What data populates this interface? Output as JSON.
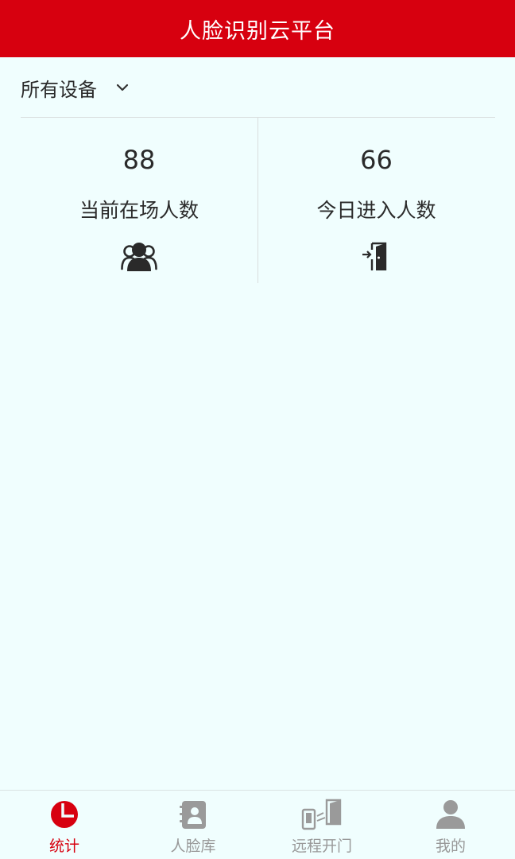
{
  "header": {
    "title": "人脸识别云平台"
  },
  "device_selector": {
    "label": "所有设备",
    "icon": "chevron-down-icon"
  },
  "stats": [
    {
      "value": "88",
      "label": "当前在场人数",
      "icon": "people-icon"
    },
    {
      "value": "66",
      "label": "今日进入人数",
      "icon": "door-enter-icon"
    }
  ],
  "tabbar": {
    "active_color": "#d7000f",
    "inactive_color": "#999999",
    "items": [
      {
        "label": "统计",
        "icon": "pie-chart-icon",
        "active": true
      },
      {
        "label": "人脸库",
        "icon": "contacts-book-icon",
        "active": false
      },
      {
        "label": "远程开门",
        "icon": "remote-door-icon",
        "active": false
      },
      {
        "label": "我的",
        "icon": "user-icon",
        "active": false
      }
    ]
  },
  "colors": {
    "brand": "#d7000f",
    "background": "#f0fefe"
  }
}
